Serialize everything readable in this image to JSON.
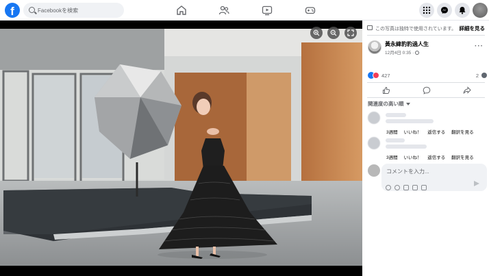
{
  "topbar": {
    "logo": "f",
    "search_placeholder": "Facebookを検索",
    "nav_icons": [
      "home-icon",
      "friends-icon",
      "video-icon",
      "gaming-icon"
    ],
    "right_icons": [
      "menu-grid-icon",
      "messenger-icon",
      "notifications-icon"
    ]
  },
  "photo": {
    "controls": [
      "zoom-in-icon",
      "zoom-out-icon",
      "fullscreen-icon"
    ]
  },
  "panel": {
    "notice_text": "この写真は独特で使用されています。",
    "notice_link": "詳細を見る",
    "author_name": "黃永緯豹豹過人生",
    "post_date": "12月4日 0:35 · ",
    "more": "···",
    "reaction_count": "427",
    "comment_count": "2",
    "section_title": "関連度の高い順",
    "suggestions": [
      {
        "actions": [
          "3週間",
          "いいね！",
          "返信する",
          "翻訳を見る"
        ]
      },
      {
        "actions": [
          "3週間",
          "いいね！",
          "返信する",
          "翻訳を見る"
        ]
      }
    ],
    "comment_placeholder": "コメントを入力..."
  },
  "colors": {
    "brand": "#1877f2",
    "love": "#f33e58"
  }
}
